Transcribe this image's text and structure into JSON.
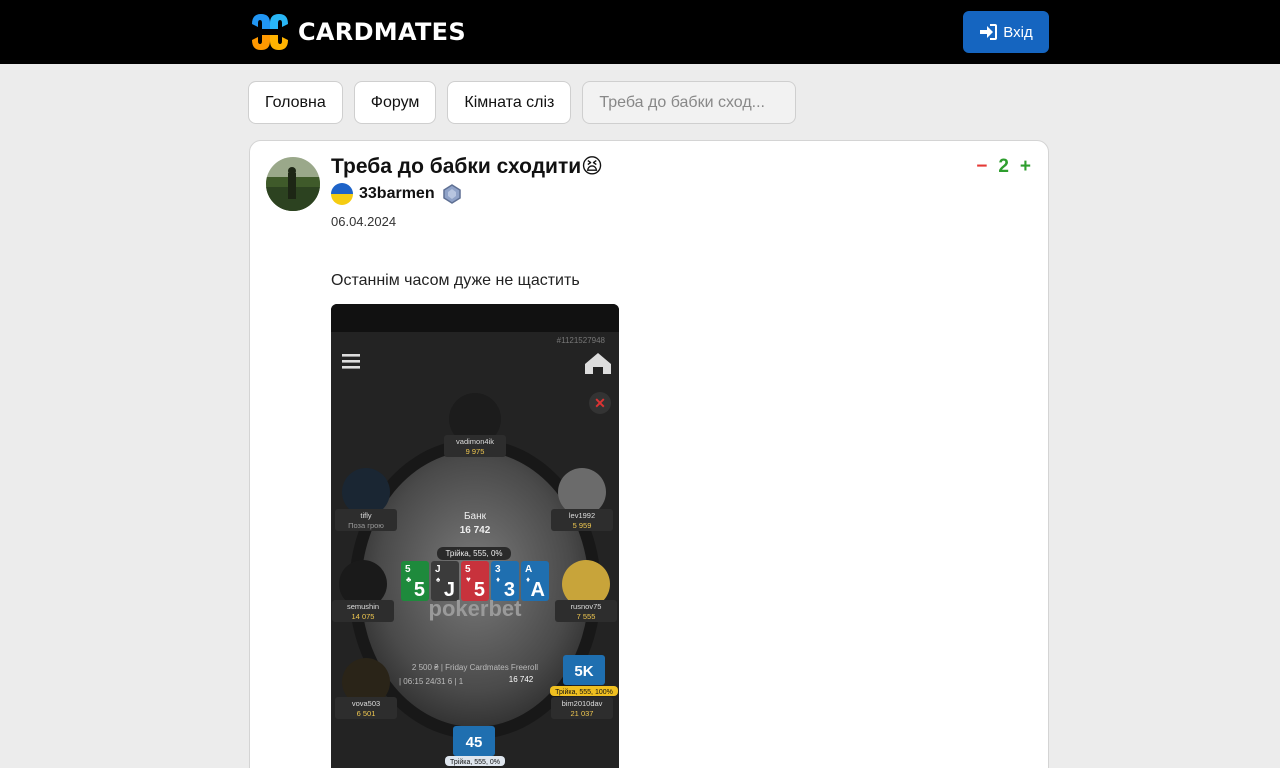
{
  "header": {
    "logo_text": "CARDMATES",
    "login_label": "Вхід"
  },
  "breadcrumbs": [
    "Головна",
    "Форум",
    "Кімната сліз",
    "Треба до бабки сход..."
  ],
  "post": {
    "title": "Треба до бабки сходити",
    "title_emoji": "😫",
    "author": "33barmen",
    "date": "06.04.2024",
    "rating": "2",
    "minus_symbol": "−",
    "plus_symbol": "+",
    "text": "Останнім часом дуже не щастить"
  },
  "screenshot": {
    "hand_id": "#1121527948",
    "bank_label": "Банк",
    "bank_value": "16 742",
    "hand_rank": "Трійка, 555, 0%",
    "brand": "pokerbet",
    "tournament": "2 500 ₴ | Friday Cardmates Freeroll",
    "tournament_info": "| 06:15  24/31  6 | 1",
    "pot_chip": "16 742",
    "board": [
      {
        "rank": "5",
        "suit": "♣",
        "color": "#1e8a3c"
      },
      {
        "rank": "J",
        "suit": "♠",
        "color": "#3b3b3b"
      },
      {
        "rank": "5",
        "suit": "♥",
        "color": "#c8323c"
      },
      {
        "rank": "3",
        "suit": "♦",
        "color": "#1f6fb0"
      },
      {
        "rank": "A",
        "suit": "♦",
        "color": "#1f6fb0"
      }
    ],
    "players": [
      {
        "name": "vadimon4ik",
        "stack": "9 975"
      },
      {
        "name": "tifly",
        "stack": "Поза грою"
      },
      {
        "name": "lev1992",
        "stack": "5 959"
      },
      {
        "name": "semushin",
        "stack": "14 075"
      },
      {
        "name": "rusnov75",
        "stack": "7 555"
      },
      {
        "name": "vova503",
        "stack": "6 501"
      },
      {
        "name": "bim2010dav",
        "stack": "21 037"
      }
    ],
    "bim_hand_rank": "Трійка, 555, 100%",
    "bim_cards": "5K",
    "hero_hand_rank": "Трійка, 555, 0%",
    "hero_cards": "45"
  },
  "colors": {
    "topbar": "#000000",
    "accent": "#1565c0",
    "minus": "#e53935",
    "plus": "#2e9e2e"
  }
}
